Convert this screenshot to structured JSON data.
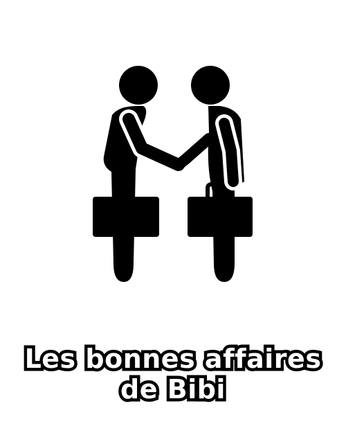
{
  "caption": {
    "line1": "Les bonnes affaires",
    "line2": "de Bibi"
  },
  "illustration": {
    "icon": "businessmen-handshake-icon",
    "fg_color": "#000000",
    "bg_color": "#ffffff"
  }
}
